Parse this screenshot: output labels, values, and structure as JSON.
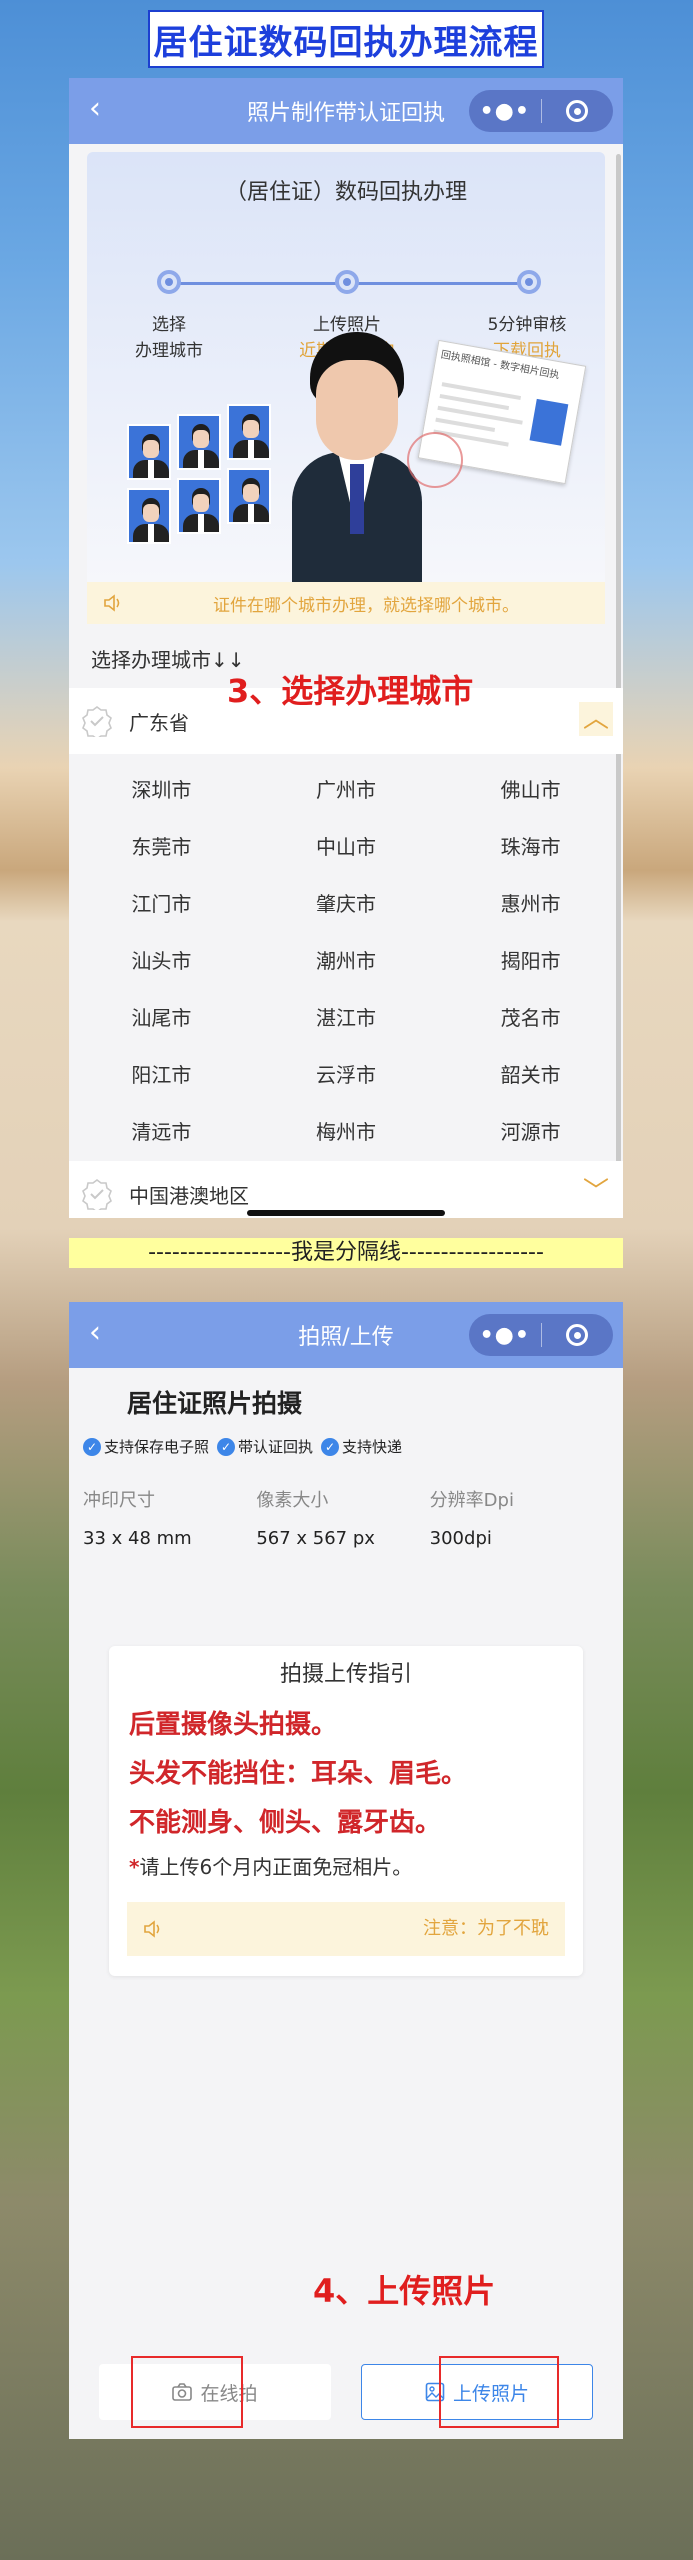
{
  "banner_title": "居住证数码回执办理流程",
  "colors": {
    "primary": "#7b9ee8",
    "accent": "#e2a53e",
    "annotation": "#e01e1e",
    "link": "#3d86e8"
  },
  "screen1": {
    "nav_title": "照片制作带认证回执",
    "back_icon": "back-arrow-icon",
    "process_title": "（居住证）数码回执办理",
    "steps": [
      {
        "line1": "选择",
        "line2": "办理城市"
      },
      {
        "line1": "上传照片",
        "line2": "近期6个月内"
      },
      {
        "line1": "5分钟审核",
        "line2": "下载回执"
      }
    ],
    "card_header": "回执照相馆 - 数字相片回执",
    "notice": "证件在哪个城市办理，就选择哪个城市。",
    "select_label": "选择办理城市↓↓",
    "province": "广东省",
    "annotation": "3、选择办理城市",
    "cities": [
      "深圳市",
      "广州市",
      "佛山市",
      "东莞市",
      "中山市",
      "珠海市",
      "江门市",
      "肇庆市",
      "惠州市",
      "汕头市",
      "潮州市",
      "揭阳市",
      "汕尾市",
      "湛江市",
      "茂名市",
      "阳江市",
      "云浮市",
      "韶关市",
      "清远市",
      "梅州市",
      "河源市"
    ],
    "region2": "中国港澳地区"
  },
  "separator": "------------------我是分隔线------------------",
  "screen2": {
    "nav_title": "拍照/上传",
    "title": "居住证照片拍摄",
    "badges": [
      "支持保存电子照",
      "带认证回执",
      "支持快递"
    ],
    "specs": [
      {
        "key": "冲印尺寸",
        "value": "33 x 48 mm"
      },
      {
        "key": "像素大小",
        "value": "567 x 567 px"
      },
      {
        "key": "分辨率Dpi",
        "value": "300dpi"
      }
    ],
    "guide_title": "拍摄上传指引",
    "guide_lines": [
      "后置摄像头拍摄。",
      "头发不能挡住：耳朵、眉毛。",
      "不能测身、侧头、露牙齿。"
    ],
    "guide_note_star": "*",
    "guide_note": "请上传6个月内正面免冠相片。",
    "guide_notice": "注意：为了不耽",
    "annotation": "4、上传照片",
    "btn_online": "在线拍",
    "btn_upload": "上传照片"
  }
}
